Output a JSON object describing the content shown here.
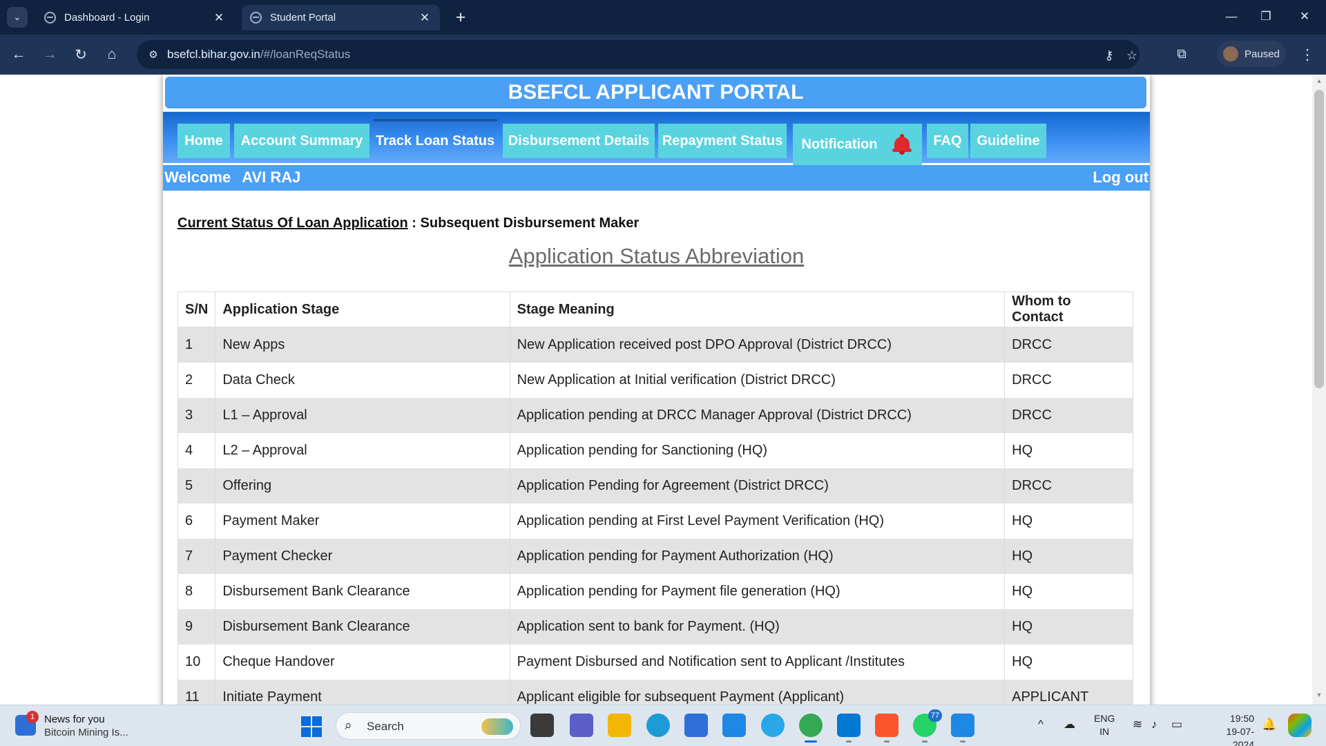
{
  "browser": {
    "tabs": [
      {
        "title": "Dashboard - Login",
        "active": false
      },
      {
        "title": "Student Portal",
        "active": true
      }
    ],
    "url_domain": "bsefcl.bihar.gov.in",
    "url_path": "/#/loanReqStatus",
    "profile_label": "Paused"
  },
  "portal": {
    "title": "BSEFCL APPLICANT PORTAL",
    "nav": [
      "Home",
      "Account Summary",
      "Track Loan Status",
      "Disbursement Details",
      "Repayment Status",
      "Notification",
      "FAQ",
      "Guideline"
    ],
    "active_nav": "Track Loan Status",
    "welcome_label": "Welcome",
    "user_name": "AVI RAJ",
    "logout_label": "Log out"
  },
  "status": {
    "label": "Current Status Of Loan Application",
    "separator": ":",
    "value": "Subsequent Disbursement Maker"
  },
  "abbreviation_title": "Application Status Abbreviation",
  "table": {
    "headers": [
      "S/N",
      "Application Stage",
      "Stage Meaning",
      "Whom to Contact"
    ],
    "rows": [
      [
        "1",
        "New Apps",
        "New Application received post DPO Approval (District DRCC)",
        "DRCC"
      ],
      [
        "2",
        "Data Check",
        "New Application at Initial verification (District DRCC)",
        "DRCC"
      ],
      [
        "3",
        "L1 – Approval",
        "Application pending at DRCC Manager Approval (District DRCC)",
        "DRCC"
      ],
      [
        "4",
        "L2 – Approval",
        "Application pending for Sanctioning (HQ)",
        "HQ"
      ],
      [
        "5",
        "Offering",
        "Application Pending for Agreement (District DRCC)",
        "DRCC"
      ],
      [
        "6",
        "Payment Maker",
        "Application pending at First Level Payment Verification (HQ)",
        "HQ"
      ],
      [
        "7",
        "Payment Checker",
        "Application pending for Payment Authorization (HQ)",
        "HQ"
      ],
      [
        "8",
        "Disbursement Bank Clearance",
        "Application pending for Payment file generation (HQ)",
        "HQ"
      ],
      [
        "9",
        "Disbursement Bank Clearance",
        "Application sent to bank for Payment. (HQ)",
        "HQ"
      ],
      [
        "10",
        "Cheque Handover",
        "Payment Disbursed and Notification sent to Applicant /Institutes",
        "HQ"
      ],
      [
        "11",
        "Initiate Payment",
        "Applicant eligible for subsequent Payment (Applicant)",
        "APPLICANT"
      ]
    ]
  },
  "taskbar": {
    "news_title": "News for you",
    "news_subtitle": "Bitcoin Mining Is...",
    "news_badge": "1",
    "search_placeholder": "Search",
    "whatsapp_badge": "77",
    "lang_line1": "ENG",
    "lang_line2": "IN",
    "time": "19:50",
    "date": "19-07-2024"
  },
  "colors": {
    "portal_header": "#4aa0f5",
    "nav_item": "#5ad3e0",
    "browser_frame": "#0f2341"
  }
}
